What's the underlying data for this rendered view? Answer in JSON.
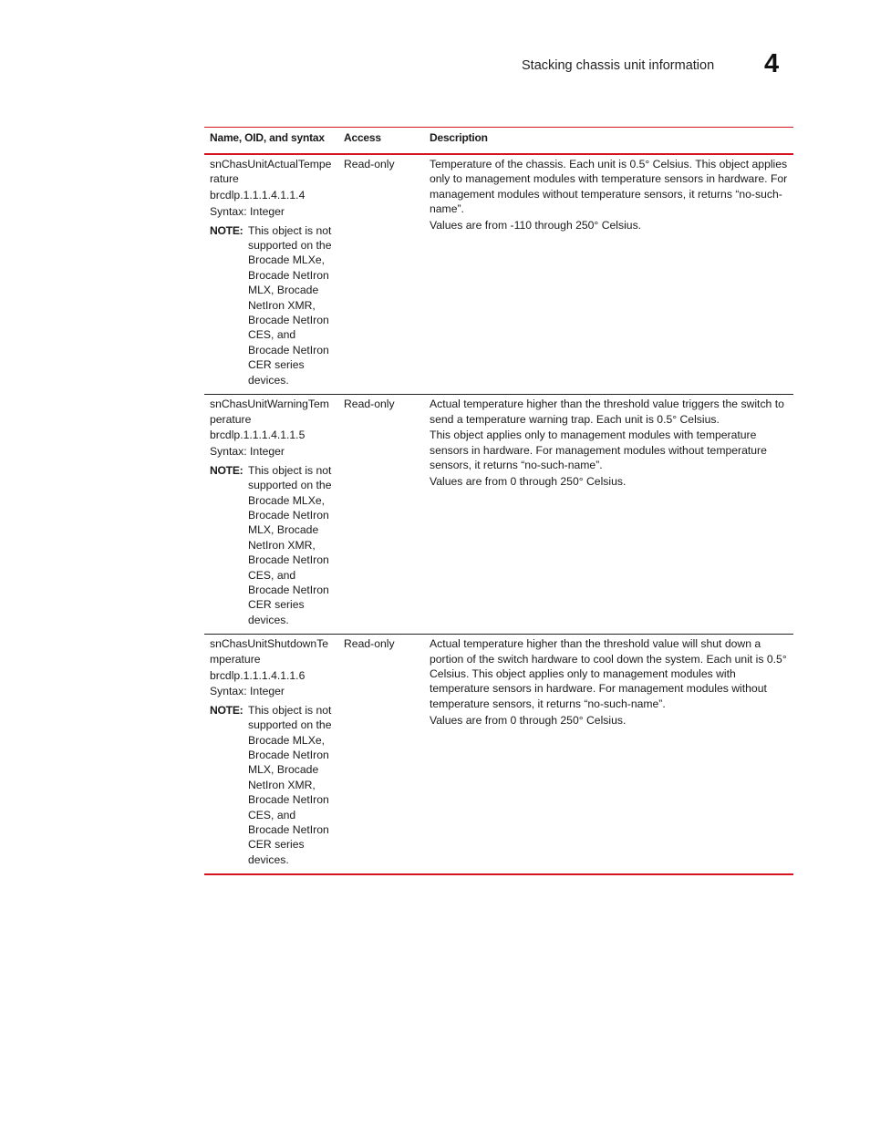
{
  "page_header": {
    "section_title": "Stacking chassis unit information",
    "chapter_number": "4"
  },
  "table": {
    "columns": [
      "Name, OID, and syntax",
      "Access",
      "Description"
    ],
    "rows": [
      {
        "name": "snChasUnitActualTemperature",
        "oid": "brcdlp.1.1.1.4.1.1.4",
        "syntax": "Syntax: Integer",
        "note_label": "NOTE:",
        "note_text": "This object is not supported on the Brocade MLXe, Brocade NetIron MLX, Brocade NetIron XMR, Brocade NetIron CES, and Brocade NetIron CER series devices.",
        "access": "Read-only",
        "description": [
          "Temperature of the chassis. Each unit is 0.5° Celsius. This object applies only to management modules with temperature sensors in hardware. For management modules without temperature sensors, it returns “no-such-name”.",
          "Values are from -110 through 250° Celsius."
        ]
      },
      {
        "name": "snChasUnitWarningTemperature",
        "oid": "brcdlp.1.1.1.4.1.1.5",
        "syntax": "Syntax: Integer",
        "note_label": "NOTE:",
        "note_text": "This object is not supported on the Brocade MLXe, Brocade NetIron MLX, Brocade NetIron XMR, Brocade NetIron CES, and Brocade NetIron CER series devices.",
        "access": "Read-only",
        "description": [
          "Actual temperature higher than the threshold value triggers the switch to send a temperature warning trap. Each unit is 0.5° Celsius.",
          "This object applies only to management modules with temperature sensors in hardware. For management modules without temperature sensors, it returns “no-such-name”.",
          "Values are from 0 through 250° Celsius."
        ]
      },
      {
        "name": "snChasUnitShutdownTemperature",
        "oid": "brcdlp.1.1.1.4.1.1.6",
        "syntax": "Syntax: Integer",
        "note_label": "NOTE:",
        "note_text": "This object is not supported on the Brocade MLXe, Brocade NetIron MLX, Brocade NetIron XMR, Brocade NetIron CES, and Brocade NetIron CER series devices.",
        "access": "Read-only",
        "description": [
          "Actual temperature higher than the threshold value will shut down a portion of the switch hardware to cool down the system. Each unit is 0.5° Celsius. This object applies only to management modules with temperature sensors in hardware. For management modules without temperature sensors, it returns “no-such-name”.",
          "Values are from 0 through 250° Celsius."
        ]
      }
    ]
  },
  "colors": {
    "rule_accent": "#d7131f"
  }
}
